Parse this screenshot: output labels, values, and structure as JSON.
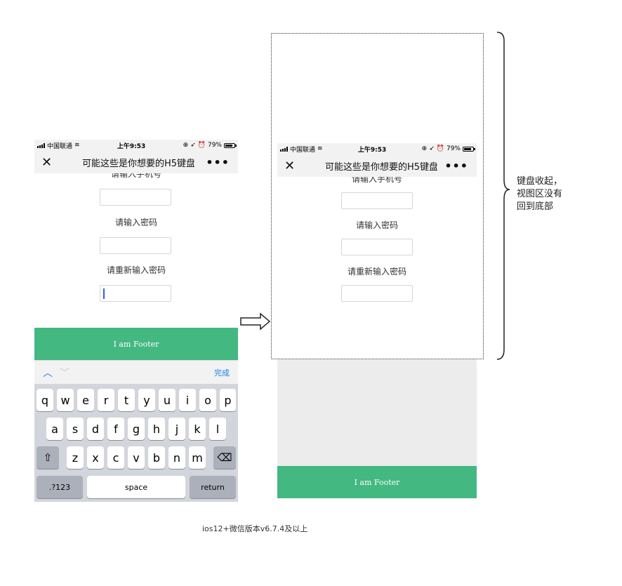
{
  "left_phone": {
    "status": {
      "carrier": "中国联通",
      "time": "上午9:53",
      "battery": "79%"
    },
    "nav": {
      "close": "✕",
      "title": "可能这些是你想要的H5键盘",
      "more": "•••"
    },
    "form": {
      "label_phone_partial": "请输入手机号",
      "label_password": "请输入密码",
      "label_confirm": "请重新输入密码"
    },
    "footer": "I am Footer",
    "keyboard": {
      "up": "︿",
      "down": "﹀",
      "done": "完成",
      "row1": [
        "q",
        "w",
        "e",
        "r",
        "t",
        "y",
        "u",
        "i",
        "o",
        "p"
      ],
      "row2": [
        "a",
        "s",
        "d",
        "f",
        "g",
        "h",
        "j",
        "k",
        "l"
      ],
      "row3": [
        "z",
        "x",
        "c",
        "v",
        "b",
        "n",
        "m"
      ],
      "shift": "⇧",
      "backspace": "⌫",
      "numbers": ".?123",
      "space": "space",
      "return": "return"
    }
  },
  "right_phone": {
    "status": {
      "carrier": "中国联通",
      "time": "上午9:53",
      "battery": "79%"
    },
    "nav": {
      "close": "✕",
      "title": "可能这些是你想要的H5键盘",
      "more": "•••"
    },
    "form": {
      "label_phone_partial": "请输入手机号",
      "label_password": "请输入密码",
      "label_confirm": "请重新输入密码"
    },
    "footer": "I am Footer"
  },
  "annotation": {
    "brace_text_line1": "键盘收起，",
    "brace_text_line2": "视图区没有",
    "brace_text_line3": "回到底部"
  },
  "caption": "ios12+微信版本v6.7.4及以上"
}
